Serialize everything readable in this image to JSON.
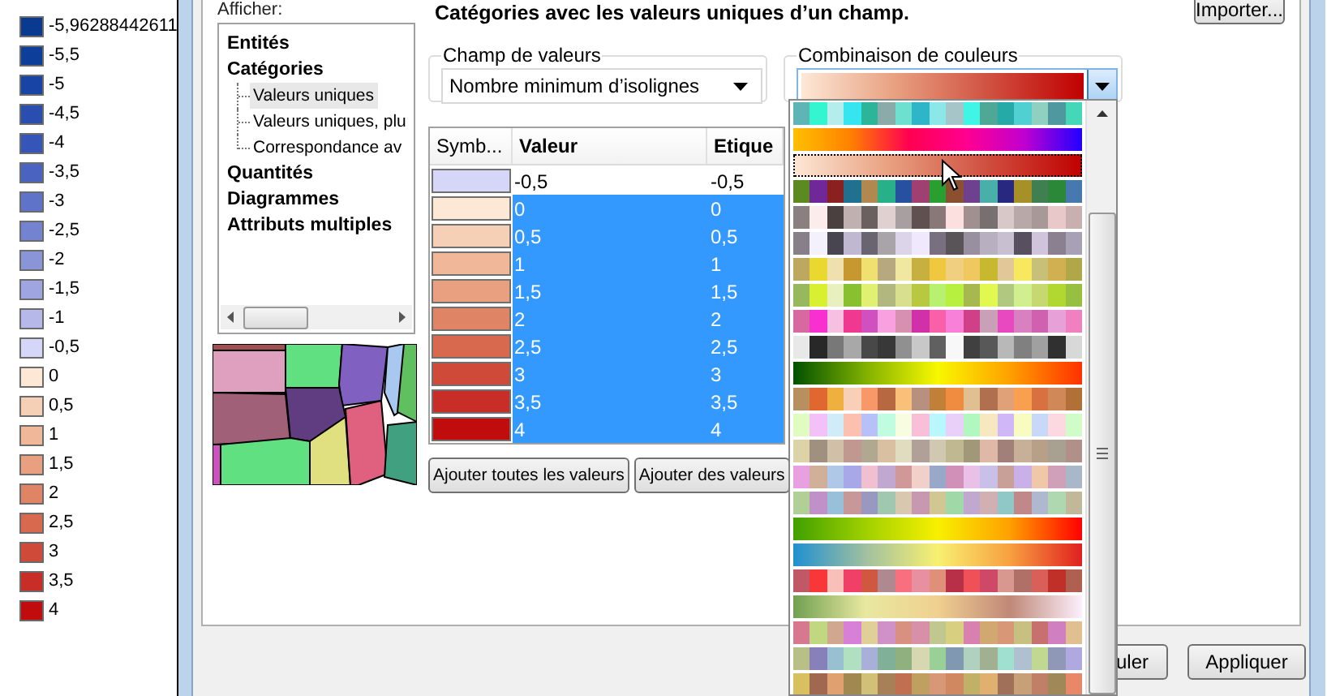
{
  "legend": [
    {
      "label": "-5,96288442611",
      "color": "#0a3a8f"
    },
    {
      "label": "-5,5",
      "color": "#0d3f9a"
    },
    {
      "label": "-5",
      "color": "#1845a5"
    },
    {
      "label": "-4,5",
      "color": "#2a4db0"
    },
    {
      "label": "-4",
      "color": "#3555b8"
    },
    {
      "label": "-3,5",
      "color": "#4a63c0"
    },
    {
      "label": "-3",
      "color": "#5f74c8"
    },
    {
      "label": "-2,5",
      "color": "#7483d0"
    },
    {
      "label": "-2",
      "color": "#8a95d8"
    },
    {
      "label": "-1,5",
      "color": "#9fa5e0"
    },
    {
      "label": "-1",
      "color": "#b6b8ea"
    },
    {
      "label": "-0,5",
      "color": "#d6d6f8"
    },
    {
      "label": "0",
      "color": "#fde8d6"
    },
    {
      "label": "0,5",
      "color": "#f6d0b6"
    },
    {
      "label": "1",
      "color": "#f0b898"
    },
    {
      "label": "1,5",
      "color": "#e8a080"
    },
    {
      "label": "2",
      "color": "#e08466"
    },
    {
      "label": "2,5",
      "color": "#d8684e"
    },
    {
      "label": "3",
      "color": "#d04a3a"
    },
    {
      "label": "3,5",
      "color": "#c82d28"
    },
    {
      "label": "4",
      "color": "#c00c0c"
    }
  ],
  "tree": {
    "label": "Afficher:",
    "items": [
      {
        "label": "Entités",
        "selected": false
      },
      {
        "label": "Catégories",
        "selected": false,
        "children": [
          {
            "label": "Valeurs uniques",
            "selected": true
          },
          {
            "label": "Valeurs uniques, plu",
            "selected": false
          },
          {
            "label": "Correspondance av",
            "selected": false
          }
        ]
      },
      {
        "label": "Quantités",
        "selected": false
      },
      {
        "label": "Diagrammes",
        "selected": false
      },
      {
        "label": "Attributs multiples",
        "selected": false
      }
    ]
  },
  "title": "Catégories avec les valeurs uniques d’un champ.",
  "import_button": "Importer...",
  "value_field": {
    "label": "Champ de valeurs",
    "value": "Nombre minimum d’isolignes"
  },
  "color_scheme": {
    "label": "Combinaison de couleurs",
    "palettes": [
      {
        "kind": "discrete",
        "selected": false
      },
      {
        "kind": "gradient",
        "selected": false
      },
      {
        "kind": "gradient",
        "selected": true
      },
      {
        "kind": "discrete",
        "selected": false
      },
      {
        "kind": "discrete",
        "selected": false
      },
      {
        "kind": "discrete",
        "selected": false
      },
      {
        "kind": "discrete",
        "selected": false
      },
      {
        "kind": "discrete",
        "selected": false
      },
      {
        "kind": "discrete",
        "selected": false
      },
      {
        "kind": "discrete",
        "selected": false
      },
      {
        "kind": "gradient",
        "selected": false
      },
      {
        "kind": "discrete",
        "selected": false
      },
      {
        "kind": "discrete",
        "selected": false
      },
      {
        "kind": "discrete",
        "selected": false
      },
      {
        "kind": "discrete",
        "selected": false
      },
      {
        "kind": "discrete",
        "selected": false
      },
      {
        "kind": "gradient",
        "selected": false
      },
      {
        "kind": "gradient",
        "selected": false
      },
      {
        "kind": "discrete",
        "selected": false
      },
      {
        "kind": "gradient",
        "selected": false
      },
      {
        "kind": "discrete",
        "selected": false
      },
      {
        "kind": "discrete",
        "selected": false
      },
      {
        "kind": "discrete",
        "selected": false
      }
    ]
  },
  "table": {
    "columns": [
      "Symb...",
      "Valeur",
      "Etique"
    ],
    "rows": [
      {
        "color": "#d6d6f8",
        "value": "-0,5",
        "label": "-0,5",
        "selected": false
      },
      {
        "color": "#fde8d6",
        "value": "0",
        "label": "0",
        "selected": true
      },
      {
        "color": "#f6d0b6",
        "value": "0,5",
        "label": "0,5",
        "selected": true
      },
      {
        "color": "#f0b898",
        "value": "1",
        "label": "1",
        "selected": true
      },
      {
        "color": "#e8a080",
        "value": "1,5",
        "label": "1,5",
        "selected": true
      },
      {
        "color": "#e08466",
        "value": "2",
        "label": "2",
        "selected": true
      },
      {
        "color": "#d8684e",
        "value": "2,5",
        "label": "2,5",
        "selected": true
      },
      {
        "color": "#d04a3a",
        "value": "3",
        "label": "3",
        "selected": true
      },
      {
        "color": "#c82d28",
        "value": "3,5",
        "label": "3,5",
        "selected": true
      },
      {
        "color": "#c00c0c",
        "value": "4",
        "label": "4",
        "selected": true
      }
    ]
  },
  "table_buttons": [
    "Ajouter toutes les valeurs",
    "Ajouter des valeurs"
  ],
  "dialog_buttons": [
    "uler",
    "Appliquer"
  ]
}
